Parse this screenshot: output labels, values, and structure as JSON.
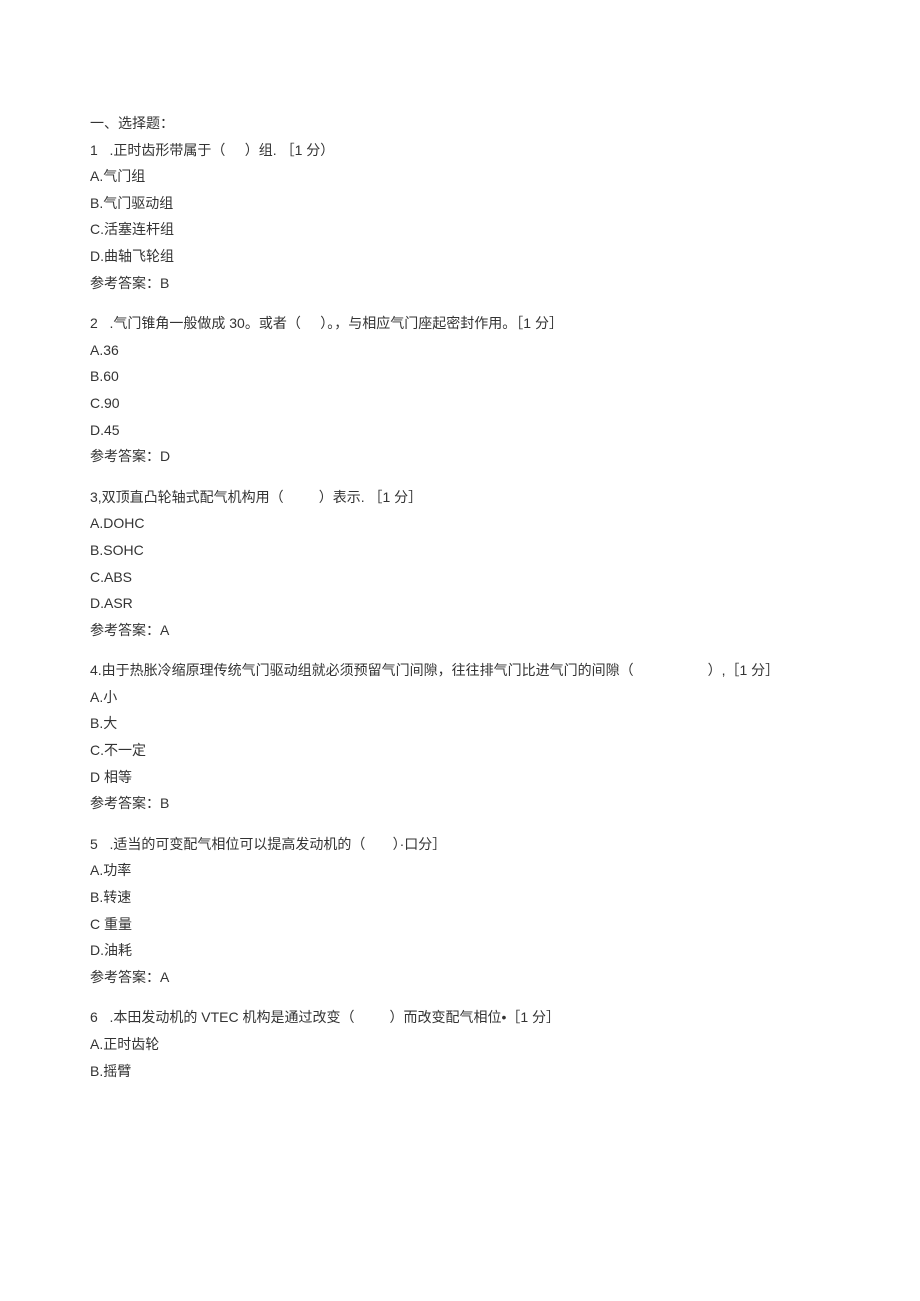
{
  "section_title": "一、选择题：",
  "questions": [
    {
      "number": "1",
      "stem": "   .正时齿形带属于（     ）组. ［1 分）",
      "options": [
        "A.气门组",
        "B.气门驱动组",
        "C.活塞连杆组",
        "D.曲轴飞轮组"
      ],
      "answer_label": "参考答案：",
      "answer": "B"
    },
    {
      "number": "2",
      "stem": "   .气门锥角一般做成 30。或者（     ）。，与相应气门座起密封作用。［1 分］",
      "options": [
        "A.36",
        "B.60",
        "C.90",
        "D.45"
      ],
      "answer_label": "参考答案：",
      "answer": "D"
    },
    {
      "number": "3",
      "stem": ",双顶直凸轮轴式配气机构用（         ）表示. ［1 分］",
      "options": [
        "A.DOHC",
        "B.SOHC",
        "C.ABS",
        "D.ASR"
      ],
      "answer_label": "参考答案：",
      "answer": "A"
    },
    {
      "number": "4",
      "stem": ".由于热胀冷缩原理传统气门驱动组就必须预留气门间隙，往往排气门比进气门的间隙（                   ）,［1 分］",
      "options": [
        "A.小",
        "B.大",
        "C.不一定",
        "D 相等"
      ],
      "answer_label": "参考答案：",
      "answer": "B"
    },
    {
      "number": "5",
      "stem": "   .适当的可变配气相位可以提高发动机的（       ）·口分］",
      "options": [
        "A.功率",
        "B.转速",
        "C 重量",
        "D.油耗"
      ],
      "answer_label": "参考答案：",
      "answer": "A"
    },
    {
      "number": "6",
      "stem": "   .本田发动机的 VTEC 机构是通过改变（         ）而改变配气相位•［1 分］",
      "options": [
        "A.正时齿轮",
        "B.摇臂"
      ],
      "answer_label": "",
      "answer": ""
    }
  ]
}
